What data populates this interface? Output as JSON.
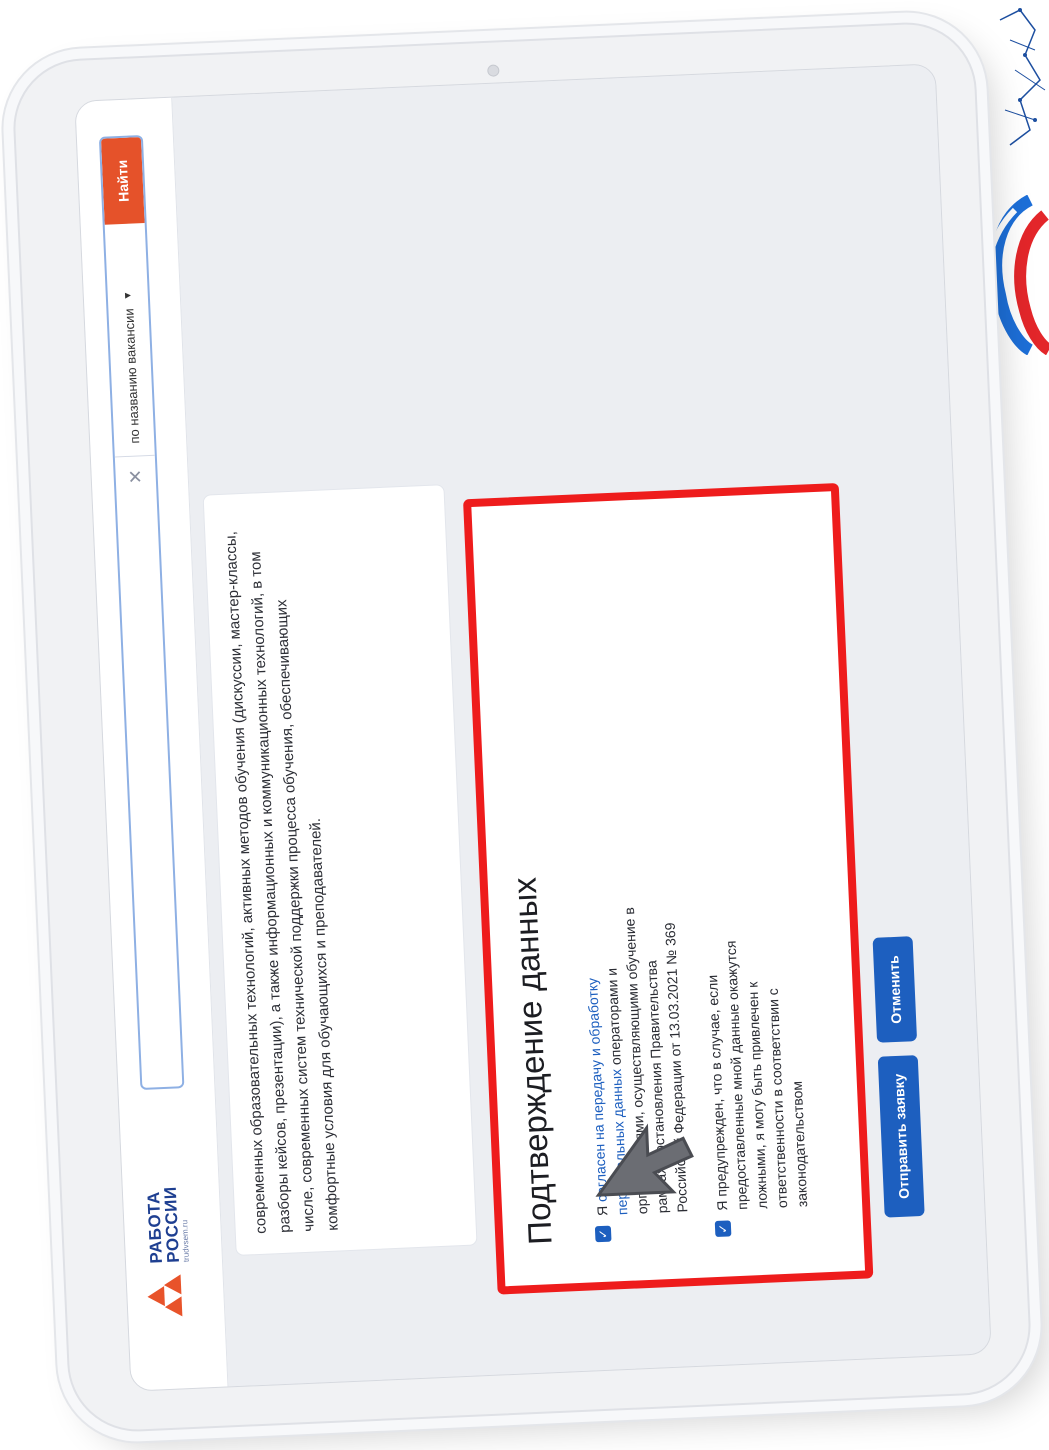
{
  "header": {
    "logo_line1": "РАБОТА",
    "logo_line2": "РОССИИ",
    "logo_sub": "trudvsem.ru",
    "search_value": "",
    "search_type": "по названию вакансии",
    "search_button": "Найти",
    "clear_icon": "close-icon"
  },
  "info": {
    "text": "современных образовательных технологий, активных методов обучения (дискуссии, мастер-классы, разборы кейсов, презентации), а также информационных и коммуникационных технологий, в том числе, современных систем технической поддержки процесса обучения, обеспечивающих комфортные условия для обучающихся и преподавателей."
  },
  "confirm": {
    "title": "Подтверждение данных",
    "check1_prefix": "Я ",
    "check1_link": "согласен на передачу и обработку персональных данных",
    "check1_rest": " операторами и организациями, осуществляющими обучение в рамках Постановления Правительства Российской Федерации от 13.03.2021 № 369",
    "check2_text": "Я предупрежден, что в случае, если предоставленные мной данные окажутся ложными, я могу быть привлечен к ответственности в соответствии с законодательством"
  },
  "buttons": {
    "submit": "Отправить заявку",
    "cancel": "Отменить"
  },
  "colors": {
    "accent": "#1d5fbf",
    "brand_orange": "#e5522a",
    "highlight": "#ee1c1c"
  }
}
